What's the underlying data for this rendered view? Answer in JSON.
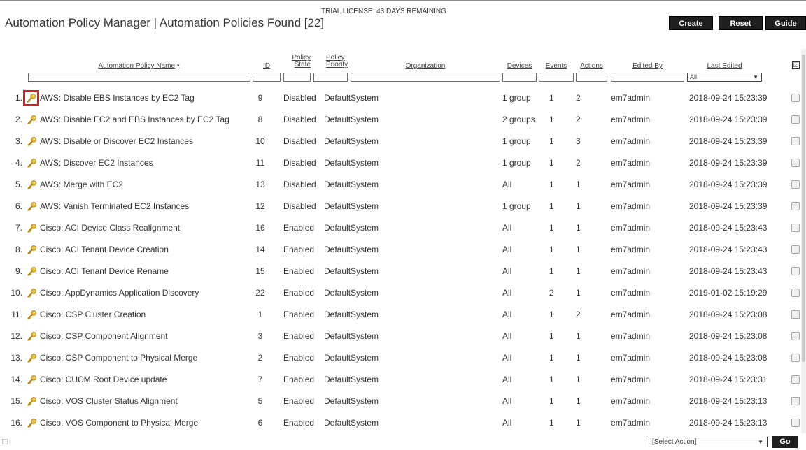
{
  "header": {
    "title": "Automation Policy Manager | Automation Policies Found [22]",
    "trial_notice": "TRIAL LICENSE: 43 DAYS REMAINING",
    "buttons": {
      "create": "Create",
      "reset": "Reset",
      "guide": "Guide"
    }
  },
  "columns": {
    "name": "Automation Policy Name",
    "id": "ID",
    "state_1": "Policy",
    "state_2": "State",
    "priority_1": "Policy",
    "priority_2": "Priority",
    "organization": "Organization",
    "devices": "Devices",
    "events": "Events",
    "actions": "Actions",
    "edited_by": "Edited By",
    "last_edited": "Last Edited",
    "last_edited_filter": "All",
    "select_all_symbol": "☑"
  },
  "rows": [
    {
      "num": "1.",
      "name": "AWS: Disable EBS Instances by EC2 Tag",
      "id": "9",
      "state": "Disabled",
      "priority": "Default",
      "org": "System",
      "devices": "1 group",
      "events": "1",
      "actions": "2",
      "editor": "em7admin",
      "edited": "2018-09-24 15:23:39"
    },
    {
      "num": "2.",
      "name": "AWS: Disable EC2 and EBS Instances by EC2 Tag",
      "id": "8",
      "state": "Disabled",
      "priority": "Default",
      "org": "System",
      "devices": "2 groups",
      "events": "1",
      "actions": "2",
      "editor": "em7admin",
      "edited": "2018-09-24 15:23:39"
    },
    {
      "num": "3.",
      "name": "AWS: Disable or Discover EC2 Instances",
      "id": "10",
      "state": "Disabled",
      "priority": "Default",
      "org": "System",
      "devices": "1 group",
      "events": "1",
      "actions": "3",
      "editor": "em7admin",
      "edited": "2018-09-24 15:23:39"
    },
    {
      "num": "4.",
      "name": "AWS: Discover EC2 Instances",
      "id": "11",
      "state": "Disabled",
      "priority": "Default",
      "org": "System",
      "devices": "1 group",
      "events": "1",
      "actions": "2",
      "editor": "em7admin",
      "edited": "2018-09-24 15:23:39"
    },
    {
      "num": "5.",
      "name": "AWS: Merge with EC2",
      "id": "13",
      "state": "Disabled",
      "priority": "Default",
      "org": "System",
      "devices": "All",
      "events": "1",
      "actions": "1",
      "editor": "em7admin",
      "edited": "2018-09-24 15:23:39"
    },
    {
      "num": "6.",
      "name": "AWS: Vanish Terminated EC2 Instances",
      "id": "12",
      "state": "Disabled",
      "priority": "Default",
      "org": "System",
      "devices": "1 group",
      "events": "1",
      "actions": "1",
      "editor": "em7admin",
      "edited": "2018-09-24 15:23:39"
    },
    {
      "num": "7.",
      "name": "Cisco: ACI Device Class Realignment",
      "id": "16",
      "state": "Enabled",
      "priority": "Default",
      "org": "System",
      "devices": "All",
      "events": "1",
      "actions": "1",
      "editor": "em7admin",
      "edited": "2018-09-24 15:23:43"
    },
    {
      "num": "8.",
      "name": "Cisco: ACI Tenant Device Creation",
      "id": "14",
      "state": "Enabled",
      "priority": "Default",
      "org": "System",
      "devices": "All",
      "events": "1",
      "actions": "1",
      "editor": "em7admin",
      "edited": "2018-09-24 15:23:43"
    },
    {
      "num": "9.",
      "name": "Cisco: ACI Tenant Device Rename",
      "id": "15",
      "state": "Enabled",
      "priority": "Default",
      "org": "System",
      "devices": "All",
      "events": "1",
      "actions": "1",
      "editor": "em7admin",
      "edited": "2018-09-24 15:23:43"
    },
    {
      "num": "10.",
      "name": "Cisco: AppDynamics Application Discovery",
      "id": "22",
      "state": "Enabled",
      "priority": "Default",
      "org": "System",
      "devices": "All",
      "events": "2",
      "actions": "1",
      "editor": "em7admin",
      "edited": "2019-01-02 15:19:29"
    },
    {
      "num": "11.",
      "name": "Cisco: CSP Cluster Creation",
      "id": "1",
      "state": "Enabled",
      "priority": "Default",
      "org": "System",
      "devices": "All",
      "events": "1",
      "actions": "2",
      "editor": "em7admin",
      "edited": "2018-09-24 15:23:08"
    },
    {
      "num": "12.",
      "name": "Cisco: CSP Component Alignment",
      "id": "3",
      "state": "Enabled",
      "priority": "Default",
      "org": "System",
      "devices": "All",
      "events": "1",
      "actions": "1",
      "editor": "em7admin",
      "edited": "2018-09-24 15:23:08"
    },
    {
      "num": "13.",
      "name": "Cisco: CSP Component to Physical Merge",
      "id": "2",
      "state": "Enabled",
      "priority": "Default",
      "org": "System",
      "devices": "All",
      "events": "1",
      "actions": "1",
      "editor": "em7admin",
      "edited": "2018-09-24 15:23:08"
    },
    {
      "num": "14.",
      "name": "Cisco: CUCM Root Device update",
      "id": "7",
      "state": "Enabled",
      "priority": "Default",
      "org": "System",
      "devices": "All",
      "events": "1",
      "actions": "1",
      "editor": "em7admin",
      "edited": "2018-09-24 15:23:31"
    },
    {
      "num": "15.",
      "name": "Cisco: VOS Cluster Status Alignment",
      "id": "5",
      "state": "Enabled",
      "priority": "Default",
      "org": "System",
      "devices": "All",
      "events": "1",
      "actions": "1",
      "editor": "em7admin",
      "edited": "2018-09-24 15:23:13"
    },
    {
      "num": "16.",
      "name": "Cisco: VOS Component to Physical Merge",
      "id": "6",
      "state": "Enabled",
      "priority": "Default",
      "org": "System",
      "devices": "All",
      "events": "1",
      "actions": "1",
      "editor": "em7admin",
      "edited": "2018-09-24 15:23:13"
    }
  ],
  "icons": {
    "row_icon": "key-icon",
    "sort_indicator": "▾"
  },
  "footer": {
    "select_action": "[Select Action]",
    "go": "Go"
  },
  "colors": {
    "button_bg": "#1f1f1f",
    "highlight": "#e0191f",
    "key_gold": "#e0b020"
  }
}
